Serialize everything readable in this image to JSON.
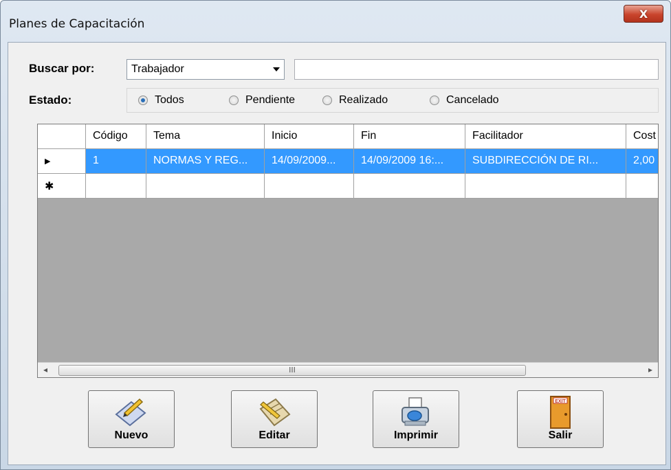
{
  "window": {
    "title": "Planes de Capacitación",
    "close_glyph": "X"
  },
  "filters": {
    "search_by_label": "Buscar por:",
    "search_by_value": "Trabajador",
    "search_text": "",
    "state_label": "Estado:",
    "state_options": [
      "Todos",
      "Pendiente",
      "Realizado",
      "Cancelado"
    ],
    "state_selected": "Todos"
  },
  "grid": {
    "columns": [
      "Código",
      "Tema",
      "Inicio",
      "Fin",
      "Facilitador",
      "Cost"
    ],
    "rows": [
      [
        "1",
        "NORMAS Y REG...",
        "14/09/2009...",
        "14/09/2009 16:...",
        "SUBDIRECCIÓN DE RI...",
        "2,00"
      ]
    ],
    "current_row_glyph": "▶",
    "new_row_glyph": "✱",
    "scroll_thumb_glyph": "III"
  },
  "buttons": {
    "new": "Nuevo",
    "edit": "Editar",
    "print": "Imprimir",
    "exit": "Salir",
    "exit_sign": "EXIT"
  }
}
